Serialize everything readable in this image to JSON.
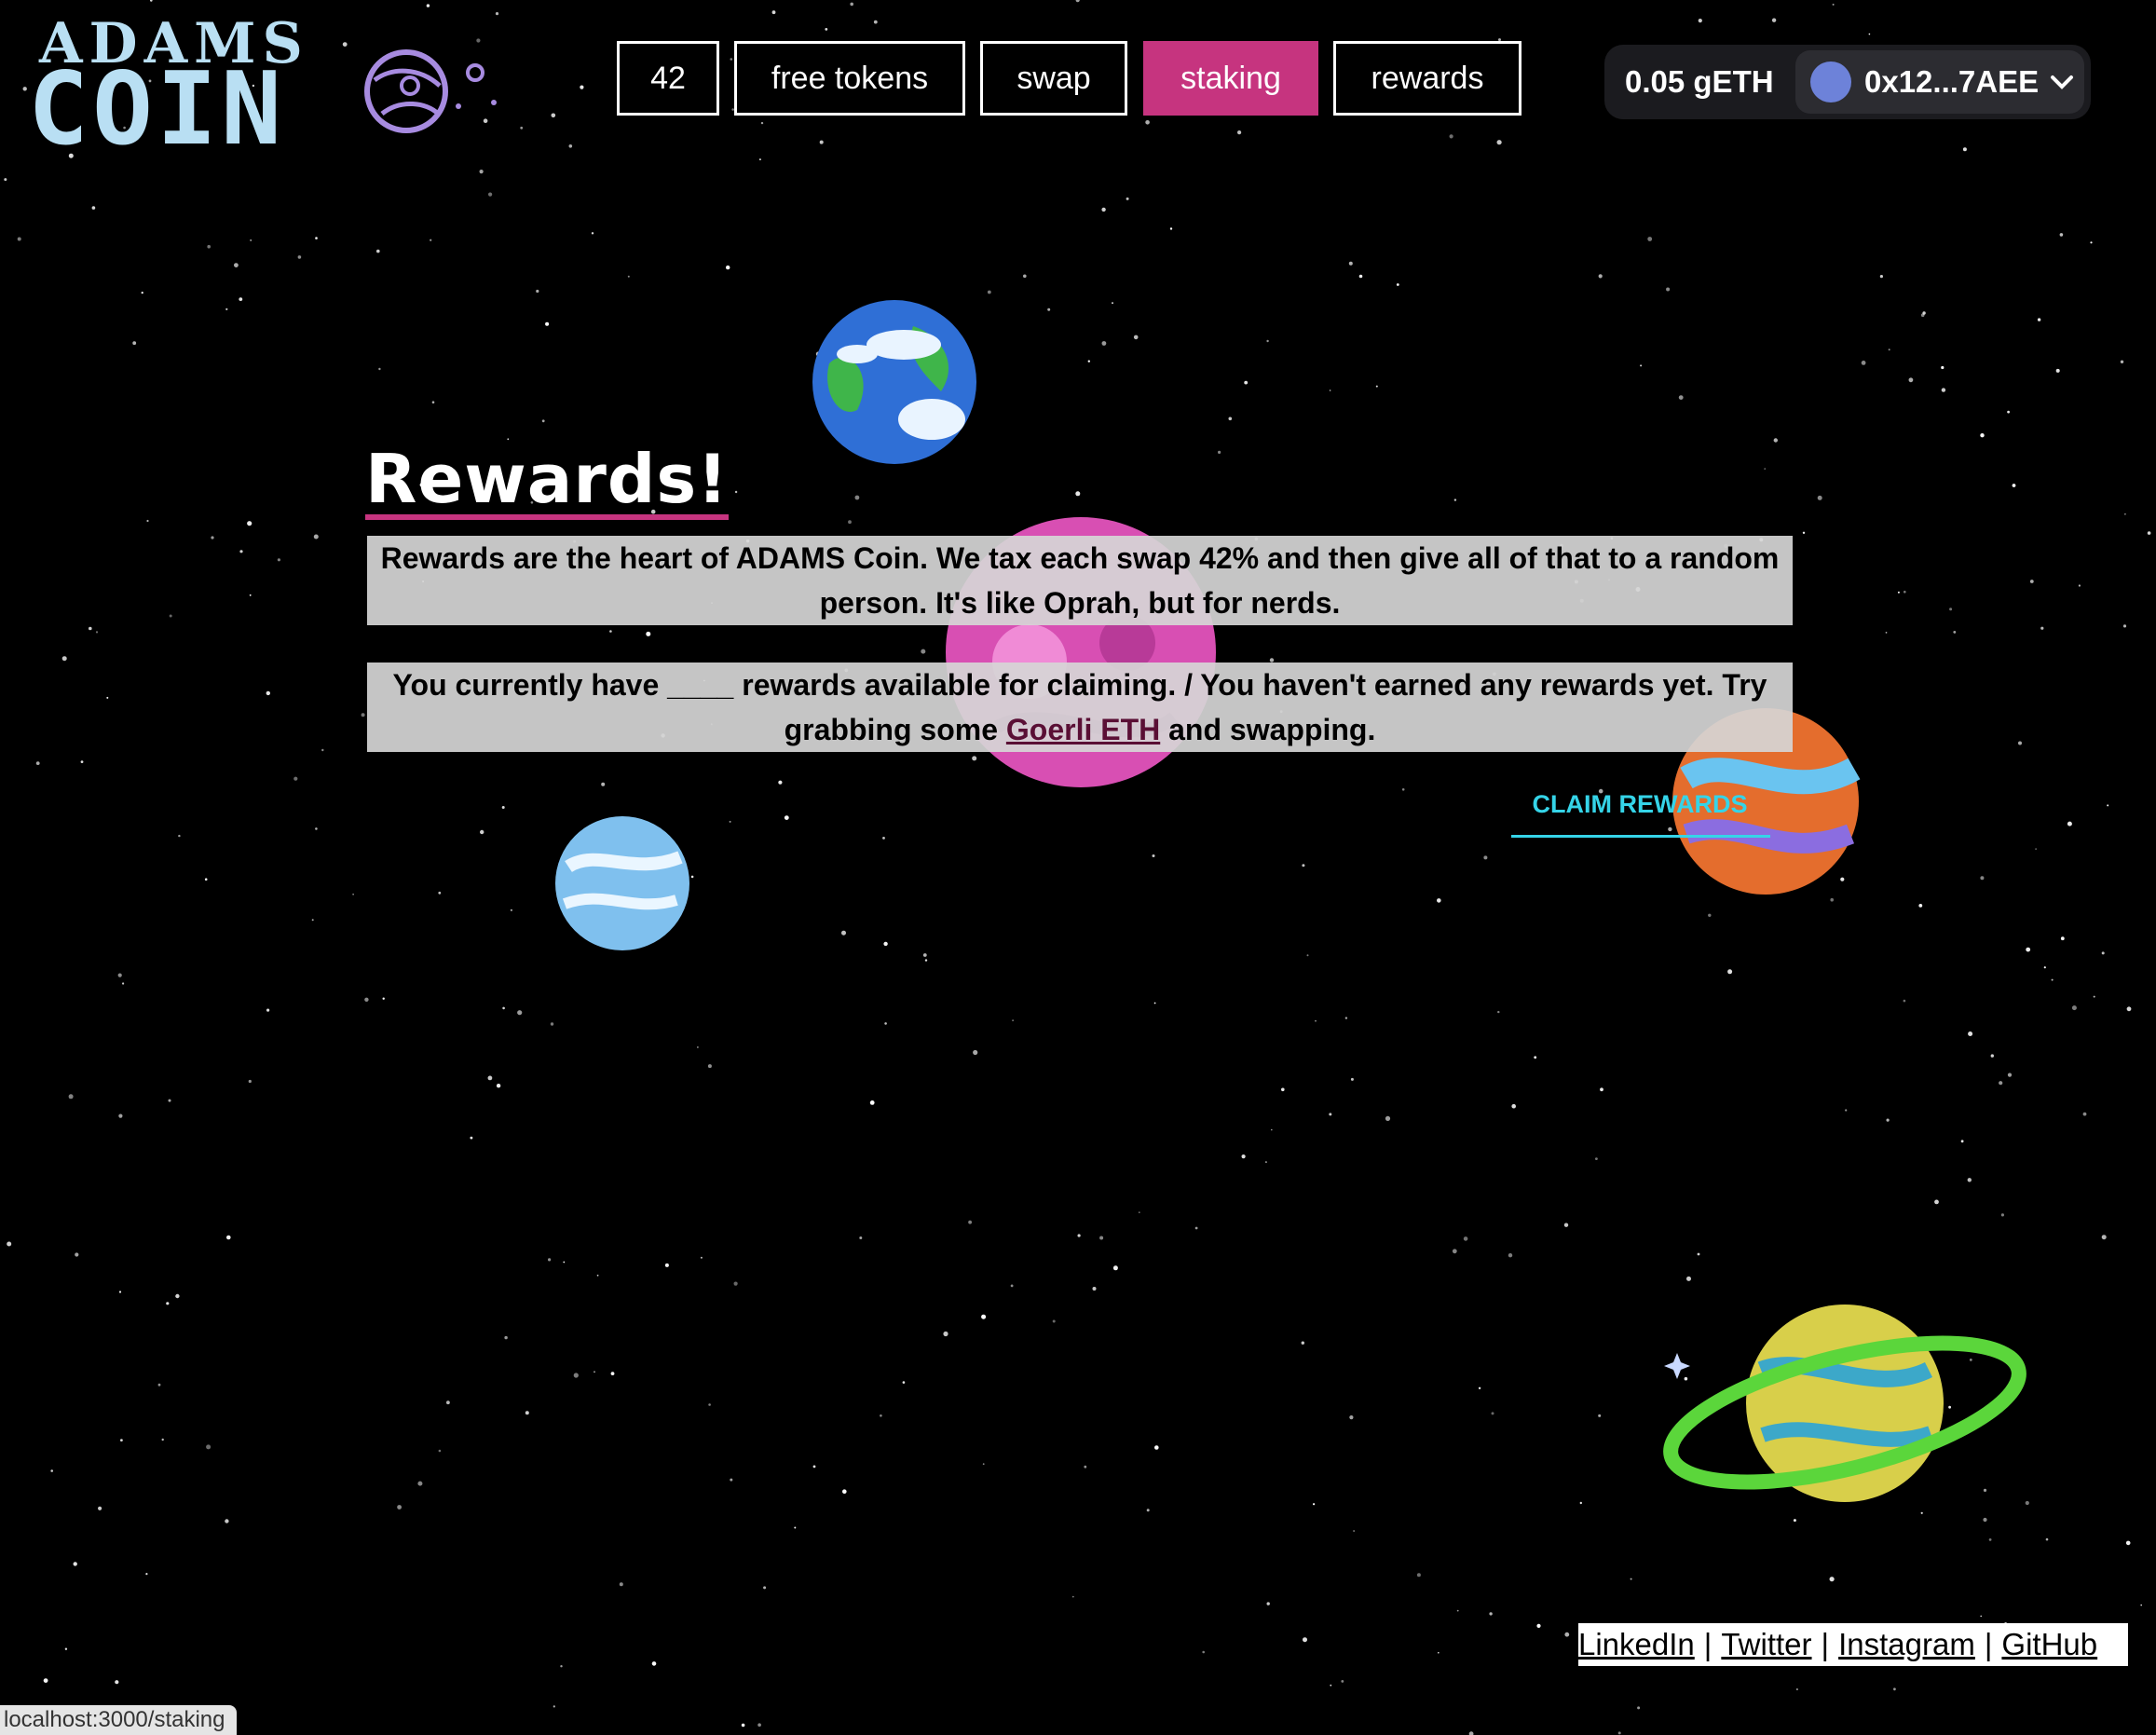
{
  "logo": {
    "line1": "ADAMS",
    "line2": "COIN"
  },
  "nav": {
    "counter": "42",
    "free_tokens": "free tokens",
    "swap": "swap",
    "staking": "staking",
    "rewards": "rewards",
    "active": "staking"
  },
  "wallet": {
    "balance": "0.05 gETH",
    "address": "0x12...7AEE"
  },
  "main": {
    "title": "Rewards!",
    "intro": "Rewards are the heart of ADAMS Coin. We tax each swap 42% and then give all of that to a random person. It's like Oprah, but for nerds.",
    "status_before_link": "You currently have ____ rewards available for claiming. / You haven't earned any rewards yet. Try grabbing some ",
    "status_link": "Goerli ETH",
    "status_after_link": " and swapping.",
    "claim_button": "CLAIM REWARDS"
  },
  "footer": {
    "links": [
      "LinkedIn",
      "Twitter",
      "Instagram",
      "GitHub"
    ],
    "separator": "|"
  },
  "statusbar": {
    "url": "localhost:3000/staking"
  },
  "colors": {
    "accent": "#c6347f",
    "logo": "#b9dff3",
    "claim": "#35d4e8",
    "background": "#000000"
  }
}
